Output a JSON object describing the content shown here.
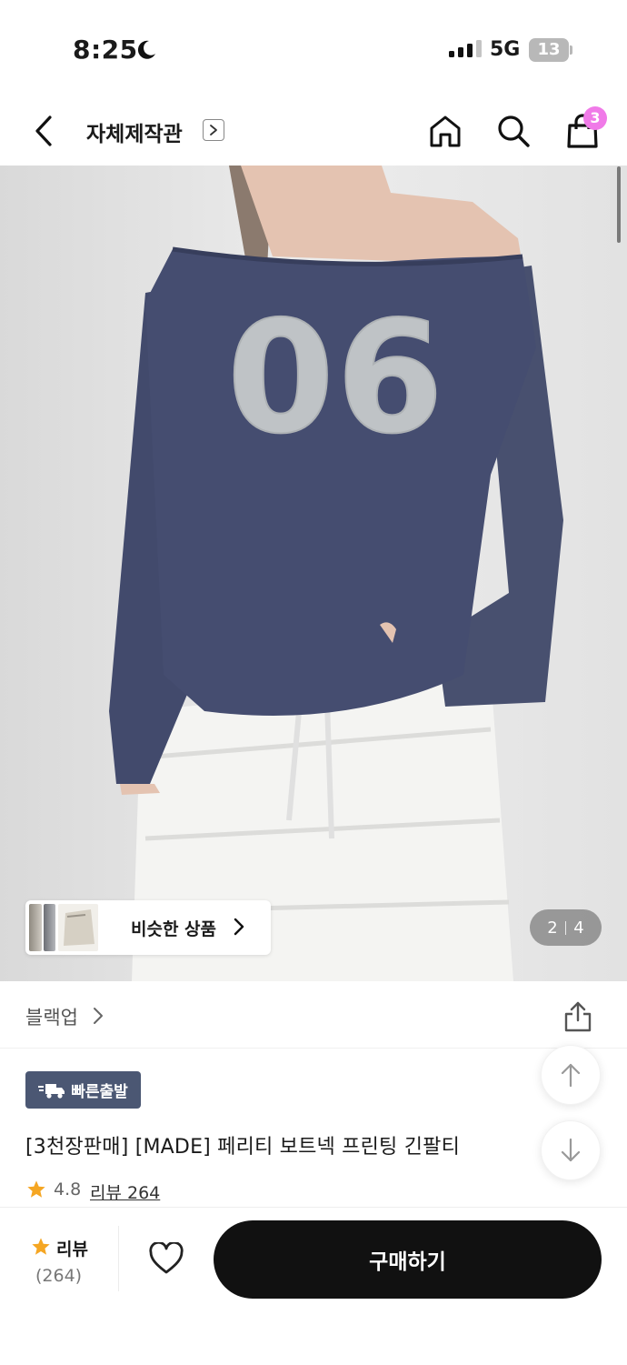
{
  "status_bar": {
    "time": "8:25",
    "network": "5G",
    "battery": "13"
  },
  "header": {
    "store_name": "자체제작관",
    "cart_count": "3"
  },
  "gallery": {
    "print_text": "06",
    "similar_label": "비슷한 상품",
    "current_page": "2",
    "total_pages": "4"
  },
  "product": {
    "brand": "블랙업",
    "badge": "빠른출발",
    "title": "[3천장판매] [MADE] 페리티 보트넥 프린팅 긴팔티",
    "rating": "4.8",
    "review_link": "리뷰 264"
  },
  "bottom_bar": {
    "review_label": "리뷰",
    "review_count": "(264)",
    "buy_label": "구매하기"
  },
  "colors": {
    "accent_badge": "#4b5773",
    "cart_badge": "#f07ae8",
    "star": "#f5a623",
    "buy_button": "#111111"
  }
}
